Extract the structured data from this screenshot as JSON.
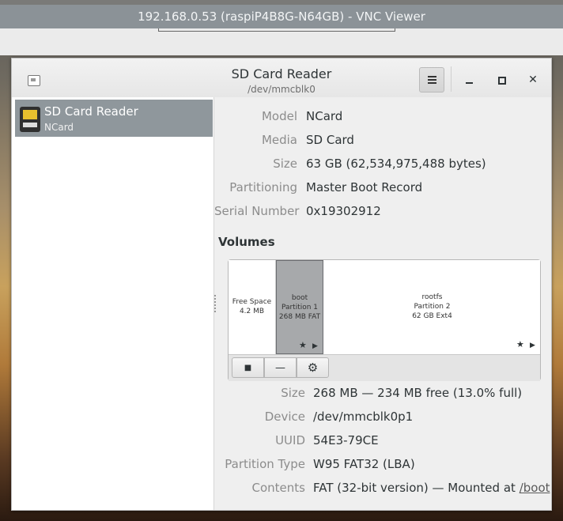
{
  "vnc": {
    "title": "192.168.0.53 (raspiP4B8G-N64GB) - VNC Viewer"
  },
  "window": {
    "title": "SD Card Reader",
    "subtitle": "/dev/mmcblk0"
  },
  "sidebar": {
    "items": [
      {
        "name": "SD Card Reader",
        "sub": "NCard"
      }
    ]
  },
  "drive": {
    "model_label": "Model",
    "model": "NCard",
    "media_label": "Media",
    "media": "SD Card",
    "size_label": "Size",
    "size": "63 GB (62,534,975,488 bytes)",
    "partitioning_label": "Partitioning",
    "partitioning": "Master Boot Record",
    "serial_label": "Serial Number",
    "serial": "0x19302912"
  },
  "volumes": {
    "header": "Volumes",
    "segments": [
      {
        "line1": "Free Space",
        "line2": "4.2 MB",
        "line3": ""
      },
      {
        "line1": "boot",
        "line2": "Partition 1",
        "line3": "268 MB FAT"
      },
      {
        "line1": "rootfs",
        "line2": "Partition 2",
        "line3": "62 GB Ext4"
      }
    ],
    "toolbar": {
      "stop": "■",
      "minus": "—",
      "gear": "⚙"
    }
  },
  "partition": {
    "size_label": "Size",
    "size": "268 MB — 234 MB free (13.0% full)",
    "device_label": "Device",
    "device": "/dev/mmcblk0p1",
    "uuid_label": "UUID",
    "uuid": "54E3-79CE",
    "type_label": "Partition Type",
    "type": "W95 FAT32 (LBA)",
    "contents_label": "Contents",
    "contents": "FAT (32-bit version) — Mounted at",
    "mount": "/boot"
  },
  "icons": {
    "window": "disks-app-icon",
    "menu": "hamburger-menu-icon",
    "sd": "sd-card-icon"
  }
}
